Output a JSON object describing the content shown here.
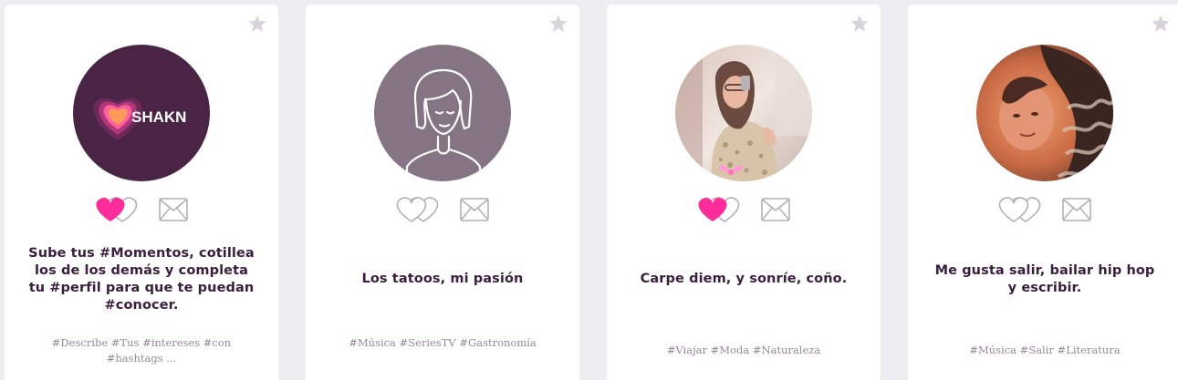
{
  "profiles": [
    {
      "description": "Sube tus #Momentos, cotillea los de los demás y completa tu #perfil para que te puedan #conocer.",
      "tags": "#Describe #Tus #intereses #con #hashtags ...",
      "avatar_text": "SHAKN",
      "avatar_kind": "shakn-logo",
      "liked": true
    },
    {
      "description": "Los tatoos, mi pasión",
      "tags": "#Música #SeriesTV #Gastronomía",
      "avatar_kind": "default-female-placeholder",
      "liked": false
    },
    {
      "description": "Carpe diem, y sonríe, coño.",
      "tags": "#Viajar #Moda #Naturaleza",
      "avatar_kind": "photo",
      "liked": true
    },
    {
      "description": "Me gusta salir, bailar hip hop y escribir.",
      "tags": "#Música #Salir #Literatura",
      "avatar_kind": "photo",
      "liked": false
    }
  ],
  "colors": {
    "accent_pink": "#ff2d9b",
    "icon_gray": "#b5adb8",
    "text_dark": "#3a1e3e",
    "tag_gray": "#948a96",
    "shakn_bg": "#4a2445",
    "placeholder_bg": "#857584"
  },
  "icons": {
    "favorite": "star-icon",
    "like": "double-heart-icon",
    "message": "envelope-icon"
  }
}
